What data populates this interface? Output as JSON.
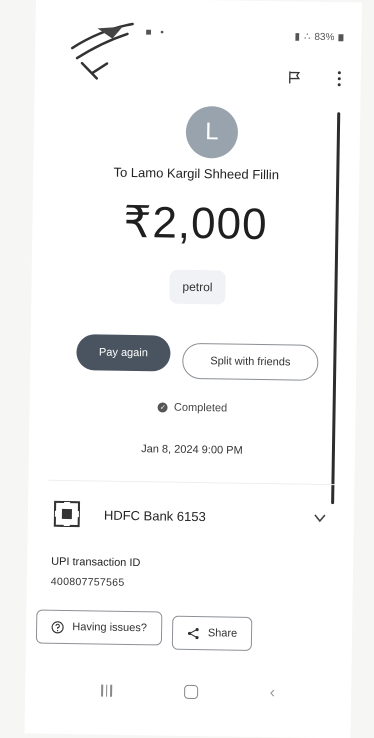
{
  "status_bar": {
    "battery": "83%"
  },
  "recipient": {
    "avatar_initial": "L",
    "line": "To Lamo Kargil Shheed Fillin"
  },
  "amount": "₹2,000",
  "note": "petrol",
  "actions": {
    "pay_again": "Pay again",
    "split": "Split with friends"
  },
  "transaction": {
    "status": "Completed",
    "datetime": "Jan 8, 2024 9:00 PM"
  },
  "bank": {
    "name": "HDFC Bank 6153"
  },
  "upi": {
    "label": "UPI transaction ID",
    "value": "400807757565"
  },
  "footer_actions": {
    "issues": "Having issues?",
    "share": "Share"
  },
  "colors": {
    "avatar": "#98a3ae",
    "pay_again_bg": "#4a5460"
  }
}
